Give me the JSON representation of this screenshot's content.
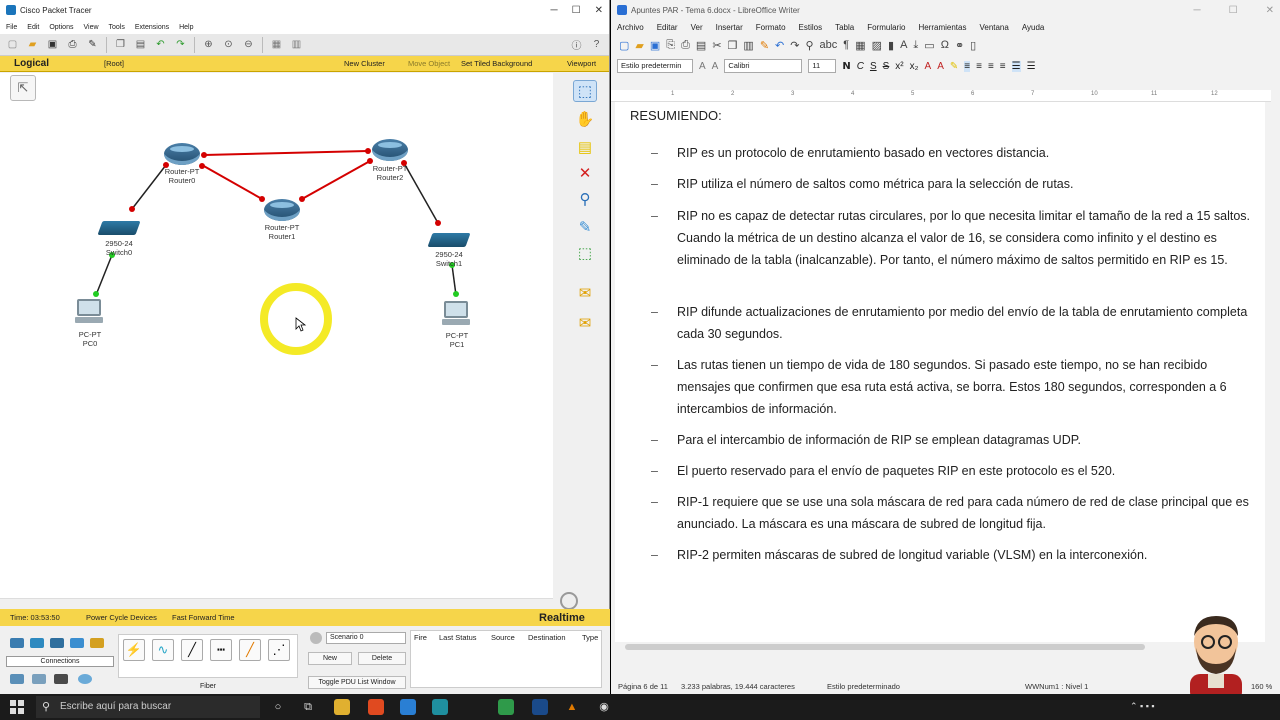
{
  "pt": {
    "title": "Cisco Packet Tracer",
    "menu": [
      "File",
      "Edit",
      "Options",
      "View",
      "Tools",
      "Extensions",
      "Help"
    ],
    "bar": {
      "logical": "Logical",
      "root": "[Root]",
      "new_cluster": "New Cluster",
      "move_object": "Move Object",
      "tiled_background": "Set Tiled Background",
      "viewport": "Viewport"
    },
    "devices": {
      "router0": {
        "type": "Router-PT",
        "name": "Router0"
      },
      "router1": {
        "type": "Router-PT",
        "name": "Router1"
      },
      "router2": {
        "type": "Router-PT",
        "name": "Router2"
      },
      "switch0": {
        "type": "2950-24",
        "name": "Switch0"
      },
      "switch1": {
        "type": "2950-24",
        "name": "Switch1"
      },
      "pc0": {
        "type": "PC-PT",
        "name": "PC0"
      },
      "pc1": {
        "type": "PC-PT",
        "name": "PC1"
      }
    },
    "status": {
      "time": "Time: 03:53:50",
      "power_cycle": "Power Cycle Devices",
      "fast_forward": "Fast Forward Time",
      "mode": "Realtime"
    },
    "bottom": {
      "connections": "Connections",
      "cable_type": "Fiber",
      "scenario": "Scenario 0",
      "new": "New",
      "delete": "Delete",
      "toggle_pdu": "Toggle PDU List Window",
      "pdu_headers": [
        "Fire",
        "Last Status",
        "Source",
        "Destination",
        "Type"
      ]
    }
  },
  "writer": {
    "title": "Apuntes PAR - Tema 6.docx - LibreOffice Writer",
    "menu": [
      "Archivo",
      "Editar",
      "Ver",
      "Insertar",
      "Formato",
      "Estilos",
      "Tabla",
      "Formulario",
      "Herramientas",
      "Ventana",
      "Ayuda"
    ],
    "style_combo": "Estilo predetermin",
    "font_combo": "Calibri",
    "size_combo": "11",
    "format_letters": [
      "N",
      "C",
      "S",
      "S"
    ],
    "heading": "RESUMIENDO:",
    "bullets": [
      "RIP es un protocolo de enrutamiento basado en vectores distancia.",
      "RIP utiliza el número de saltos como métrica para la selección de rutas.",
      "RIP no es capaz de detectar rutas circulares, por lo que necesita limitar el tamaño de la red a 15 saltos. Cuando la métrica de un destino alcanza el valor de 16, se considera como infinito y el destino es eliminado de la tabla (inalcanzable). Por tanto, el número máximo de saltos permitido en RIP es 15.",
      "RIP difunde actualizaciones de enrutamiento por medio del envío de la tabla de enrutamiento completa cada 30 segundos.",
      "Las rutas tienen un tiempo de vida de 180 segundos. Si pasado este tiempo, no se han recibido mensajes que confirmen que esa ruta está activa, se borra. Estos 180 segundos, corresponden a 6 intercambios de información.",
      "Para el intercambio de información de RIP se emplean datagramas UDP.",
      "El puerto reservado para el envío de paquetes RIP en este protocolo es el 520.",
      "RIP-1 requiere que se use una sola máscara de red para cada número de red de clase principal que es anunciado. La máscara es una máscara de subred de longitud fija.",
      "RIP-2 permiten máscaras de subred de longitud variable (VLSM) en la interconexión."
    ],
    "status": {
      "page": "Página 6 de 11",
      "words": "3.233 palabras, 19.444 caracteres",
      "style": "Estilo predeterminado",
      "numbering": "WWNum1 : Nivel 1",
      "zoom": "160 %"
    }
  },
  "taskbar": {
    "search_placeholder": "Escribe aquí para buscar"
  },
  "colors": {
    "pt_yellow": "#f6d54a",
    "link_red": "#d40000",
    "link_black": "#222222",
    "port_green": "#22cc22",
    "cursor_ring": "#f2e600"
  }
}
